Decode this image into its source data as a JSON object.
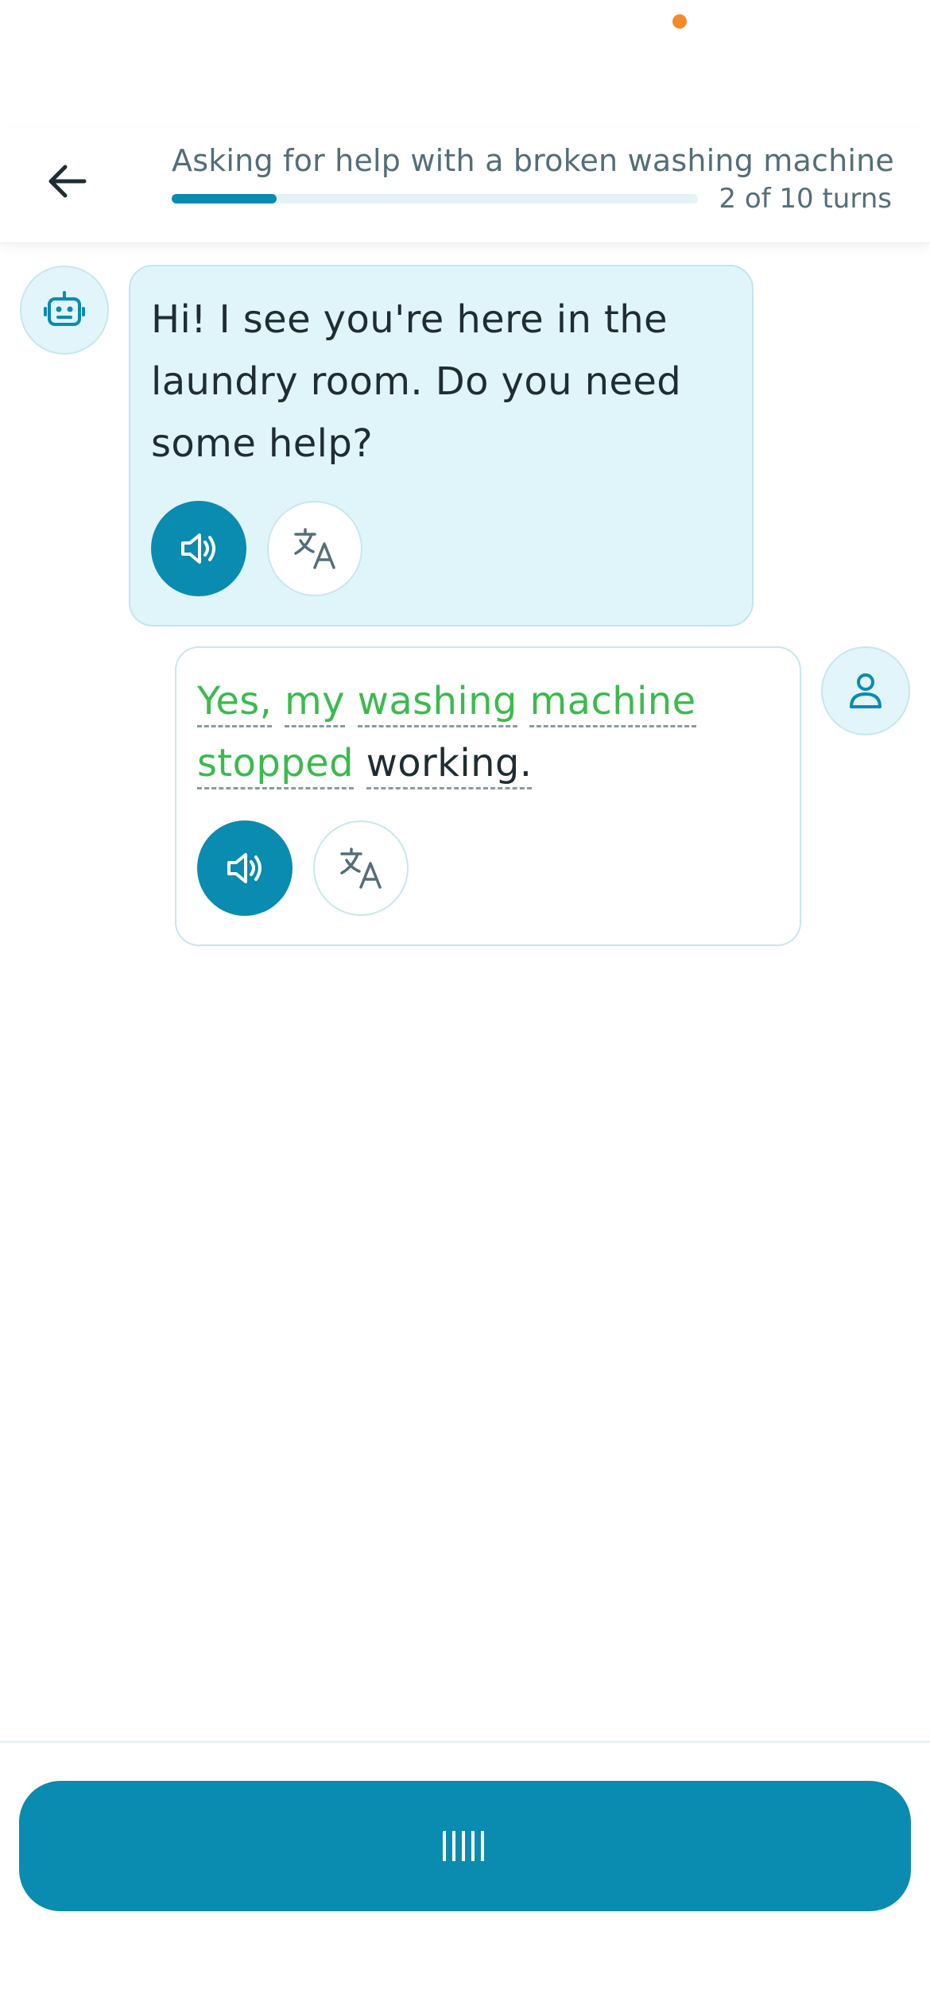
{
  "header": {
    "title": "Asking for help with a broken washing machine",
    "turns_label": "2 of 10 turns",
    "progress_fraction": 0.2
  },
  "icons": {
    "back": "arrow-left-icon",
    "bot": "robot-icon",
    "user": "user-icon",
    "speak": "speaker-icon",
    "translate": "translate-icon",
    "record": "waveform-icon"
  },
  "messages": [
    {
      "role": "bot",
      "text": "Hi! I see you're here in the laundry room. Do you need some help?"
    },
    {
      "role": "user",
      "words": [
        {
          "text": "Yes,",
          "status": "good"
        },
        {
          "text": "my",
          "status": "good"
        },
        {
          "text": "washing",
          "status": "good"
        },
        {
          "text": "machine",
          "status": "good"
        },
        {
          "text": "stopped",
          "status": "good"
        },
        {
          "text": "working.",
          "status": "plain"
        }
      ]
    }
  ],
  "colors": {
    "accent": "#0a8bb0",
    "bot_bubble": "#e0f5fa",
    "good_word": "#3cba4d",
    "status_dot": "#f58a2a"
  }
}
